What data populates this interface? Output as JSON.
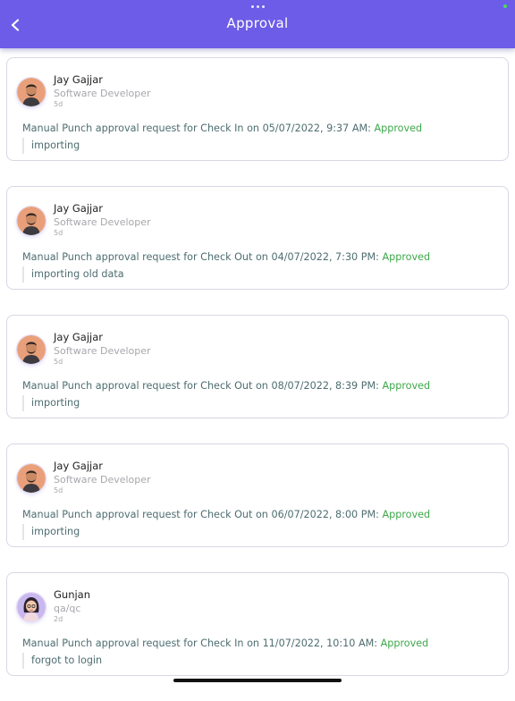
{
  "header": {
    "title": "Approval",
    "back_icon": "chevron-left-icon",
    "color": "#6c5ce7"
  },
  "colors": {
    "approved": "#3da84a",
    "message": "#4e6d70",
    "secondary_text": "#a7a7ad"
  },
  "approvals": [
    {
      "name": "Jay Gajjar",
      "role": "Software Developer",
      "time": "5d",
      "avatar": "male-avatar",
      "message": "Manual Punch approval request for Check In on 05/07/2022, 9:37 AM: ",
      "status": "Approved",
      "reason": "importing"
    },
    {
      "name": "Jay Gajjar",
      "role": "Software Developer",
      "time": "5d",
      "avatar": "male-avatar",
      "message": "Manual Punch approval request for Check Out on 04/07/2022, 7:30 PM: ",
      "status": "Approved",
      "reason": "importing old data"
    },
    {
      "name": "Jay Gajjar",
      "role": "Software Developer",
      "time": "5d",
      "avatar": "male-avatar",
      "message": "Manual Punch approval request for Check Out on 08/07/2022, 8:39 PM: ",
      "status": "Approved",
      "reason": "importing"
    },
    {
      "name": "Jay Gajjar",
      "role": "Software Developer",
      "time": "5d",
      "avatar": "male-avatar",
      "message": "Manual Punch approval request for Check Out on 06/07/2022, 8:00 PM: ",
      "status": "Approved",
      "reason": "importing"
    },
    {
      "name": "Gunjan",
      "role": "qa/qc",
      "time": "2d",
      "avatar": "female-avatar",
      "message": "Manual Punch approval request for Check In on 11/07/2022, 10:10 AM: ",
      "status": "Approved",
      "reason": "forgot to login"
    }
  ]
}
